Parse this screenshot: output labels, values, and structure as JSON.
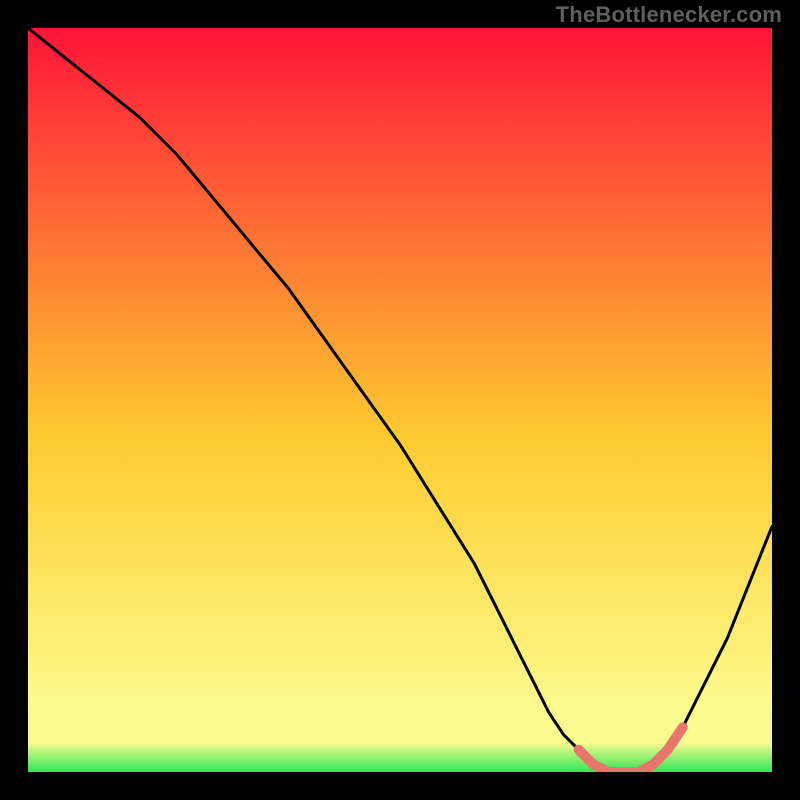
{
  "attribution": "TheBottlenecker.com",
  "colors": {
    "bg": "#000000",
    "curve": "#000000",
    "accent": "#e8766c",
    "grad_top": "#ff1439",
    "grad_mid": "#fecb2f",
    "grad_low": "#fbfc8e",
    "grad_bottom": "#2fe758"
  },
  "chart_data": {
    "type": "line",
    "title": "",
    "xlabel": "",
    "ylabel": "",
    "xlim": [
      0,
      100
    ],
    "ylim": [
      0,
      100
    ],
    "grid": false,
    "legend": false,
    "annotations": [],
    "series": [
      {
        "name": "bottleneck-curve",
        "x": [
          0,
          5,
          10,
          15,
          20,
          25,
          30,
          35,
          40,
          45,
          50,
          55,
          60,
          62,
          64,
          66,
          68,
          70,
          72,
          74,
          76,
          78,
          80,
          82,
          84,
          86,
          88,
          90,
          92,
          94,
          96,
          98,
          100
        ],
        "values": [
          100,
          96,
          92,
          88,
          83,
          77,
          71,
          65,
          58,
          51,
          44,
          36,
          28,
          24,
          20,
          16,
          12,
          8,
          5,
          3,
          1,
          0,
          0,
          0,
          1,
          3,
          6,
          10,
          14,
          18,
          23,
          28,
          33
        ]
      },
      {
        "name": "optimal-band",
        "x": [
          74,
          76,
          78,
          80,
          82,
          84,
          86,
          88
        ],
        "values": [
          3,
          1,
          0,
          0,
          0,
          1,
          3,
          6
        ]
      }
    ]
  }
}
